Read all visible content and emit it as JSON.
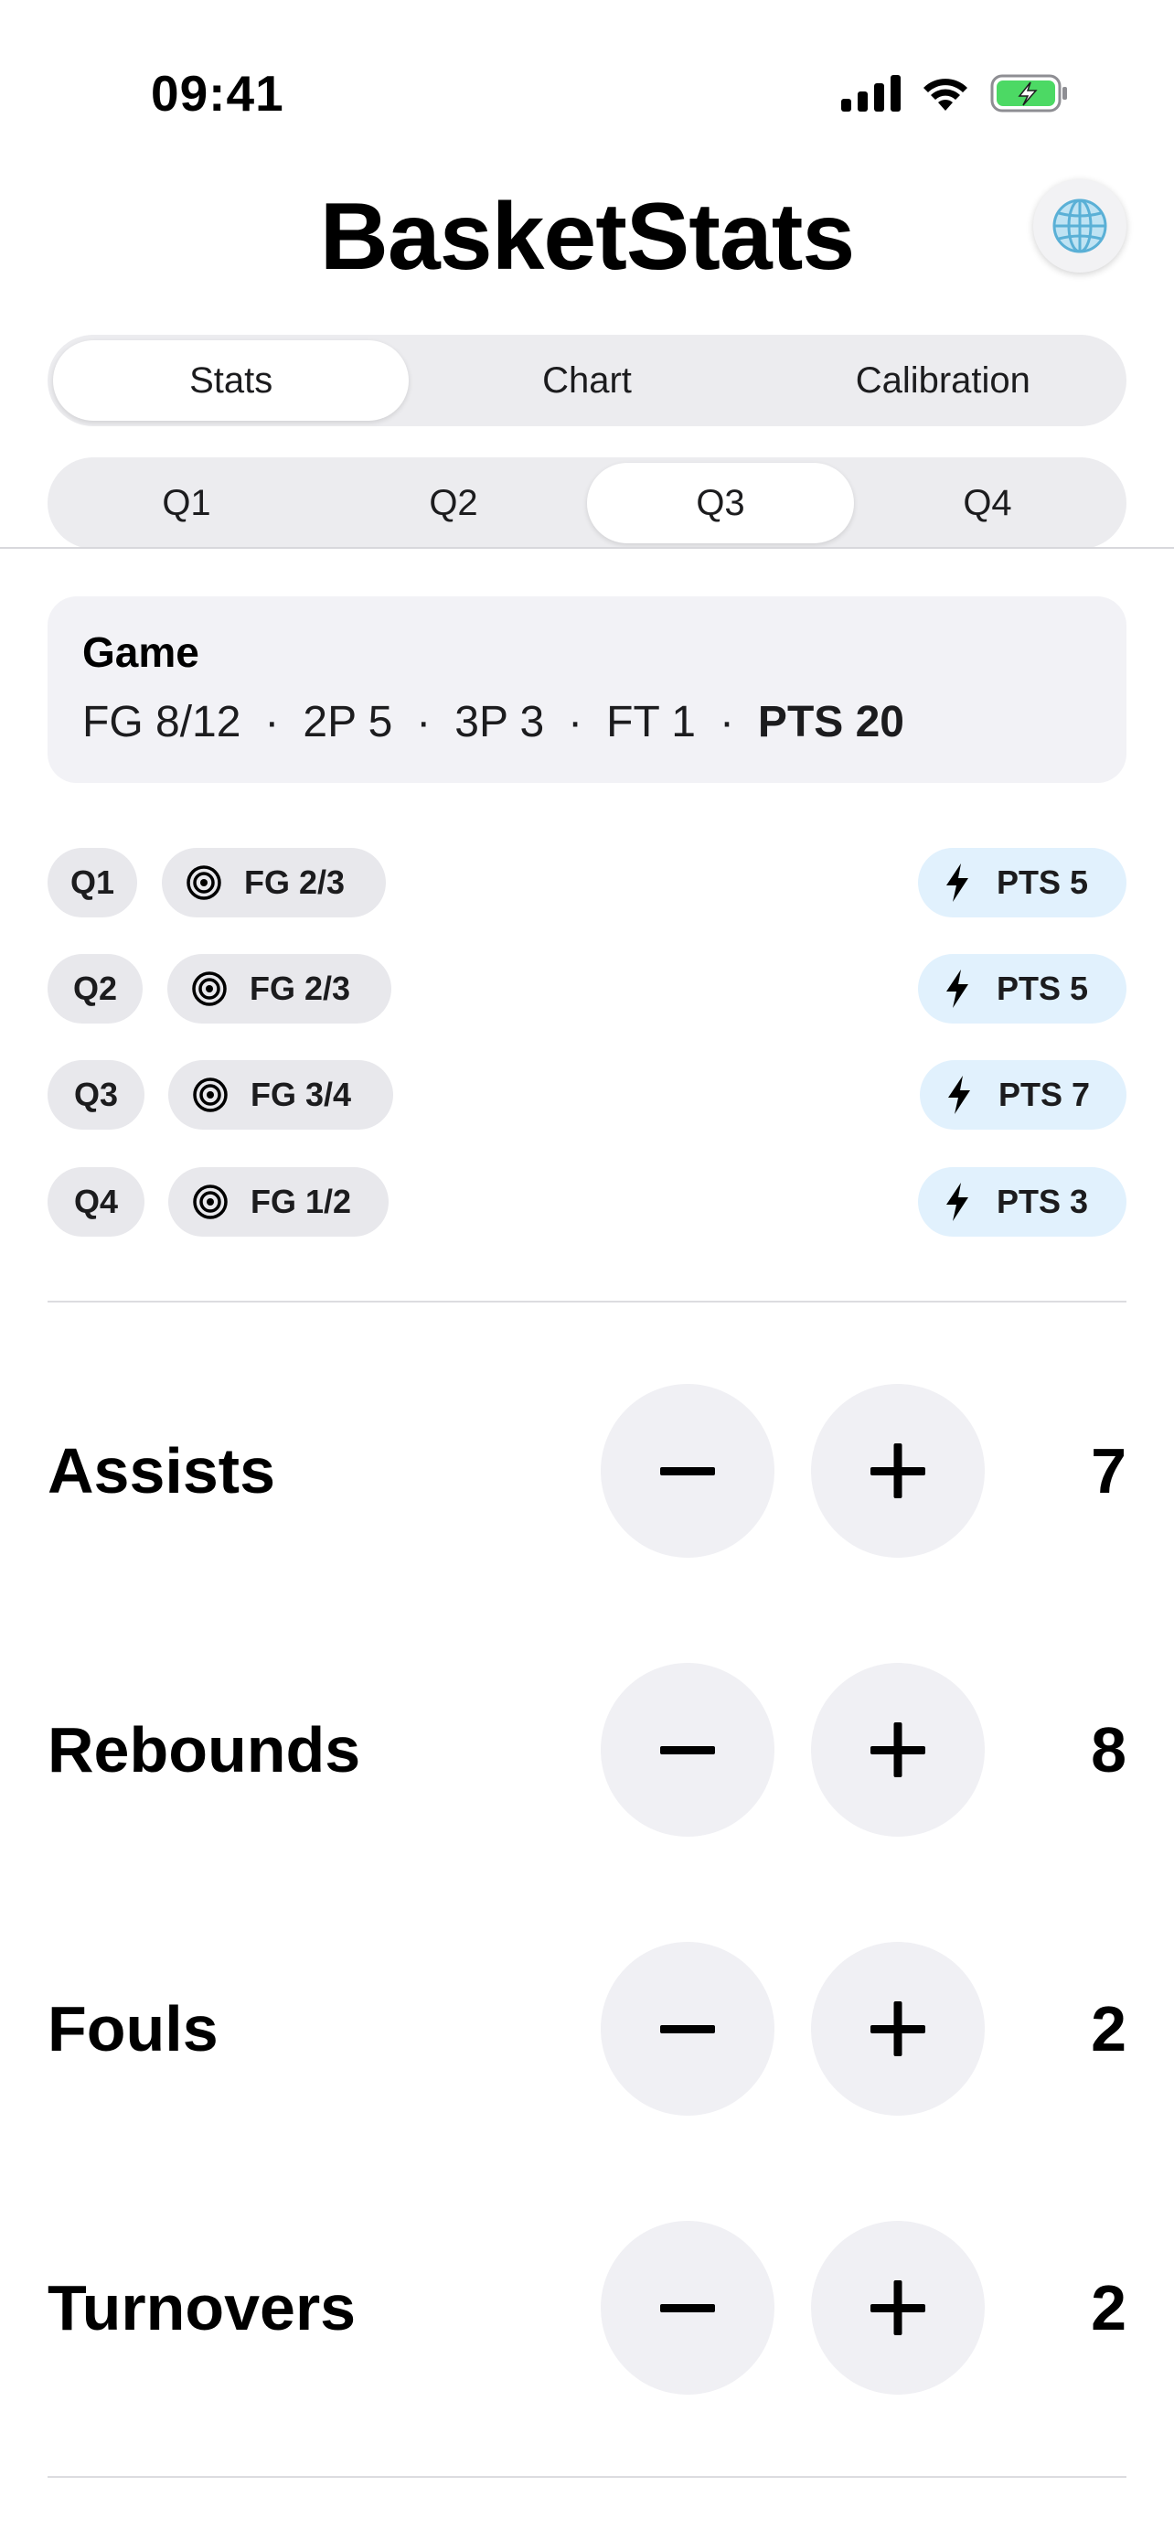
{
  "status_bar": {
    "time": "09:41"
  },
  "header": {
    "title": "BasketStats"
  },
  "main_tabs": [
    {
      "label": "Stats",
      "selected": true
    },
    {
      "label": "Chart",
      "selected": false
    },
    {
      "label": "Calibration",
      "selected": false
    }
  ],
  "quarter_tabs": [
    {
      "label": "Q1",
      "selected": false
    },
    {
      "label": "Q2",
      "selected": false
    },
    {
      "label": "Q3",
      "selected": true
    },
    {
      "label": "Q4",
      "selected": false
    }
  ],
  "game": {
    "title": "Game",
    "fg": "FG 8/12",
    "two_p": "2P 5",
    "three_p": "3P 3",
    "ft": "FT 1",
    "pts": "PTS 20",
    "separator": "·"
  },
  "quarters": [
    {
      "quarter": "Q1",
      "fg": "FG 2/3",
      "pts": "PTS 5"
    },
    {
      "quarter": "Q2",
      "fg": "FG 2/3",
      "pts": "PTS 5"
    },
    {
      "quarter": "Q3",
      "fg": "FG 3/4",
      "pts": "PTS 7"
    },
    {
      "quarter": "Q4",
      "fg": "FG 1/2",
      "pts": "PTS 3"
    }
  ],
  "counters": [
    {
      "label": "Assists",
      "value": "7"
    },
    {
      "label": "Rebounds",
      "value": "8"
    },
    {
      "label": "Fouls",
      "value": "2"
    },
    {
      "label": "Turnovers",
      "value": "2"
    }
  ],
  "icons": {
    "globe": "globe-icon",
    "target": "target-icon",
    "bolt": "bolt-icon",
    "minus": "minus-icon",
    "plus": "plus-icon"
  },
  "colors": {
    "battery_fill": "#4cd964",
    "pts_chip_bg": "#e1f1fd",
    "globe": "#5ab0d6"
  }
}
